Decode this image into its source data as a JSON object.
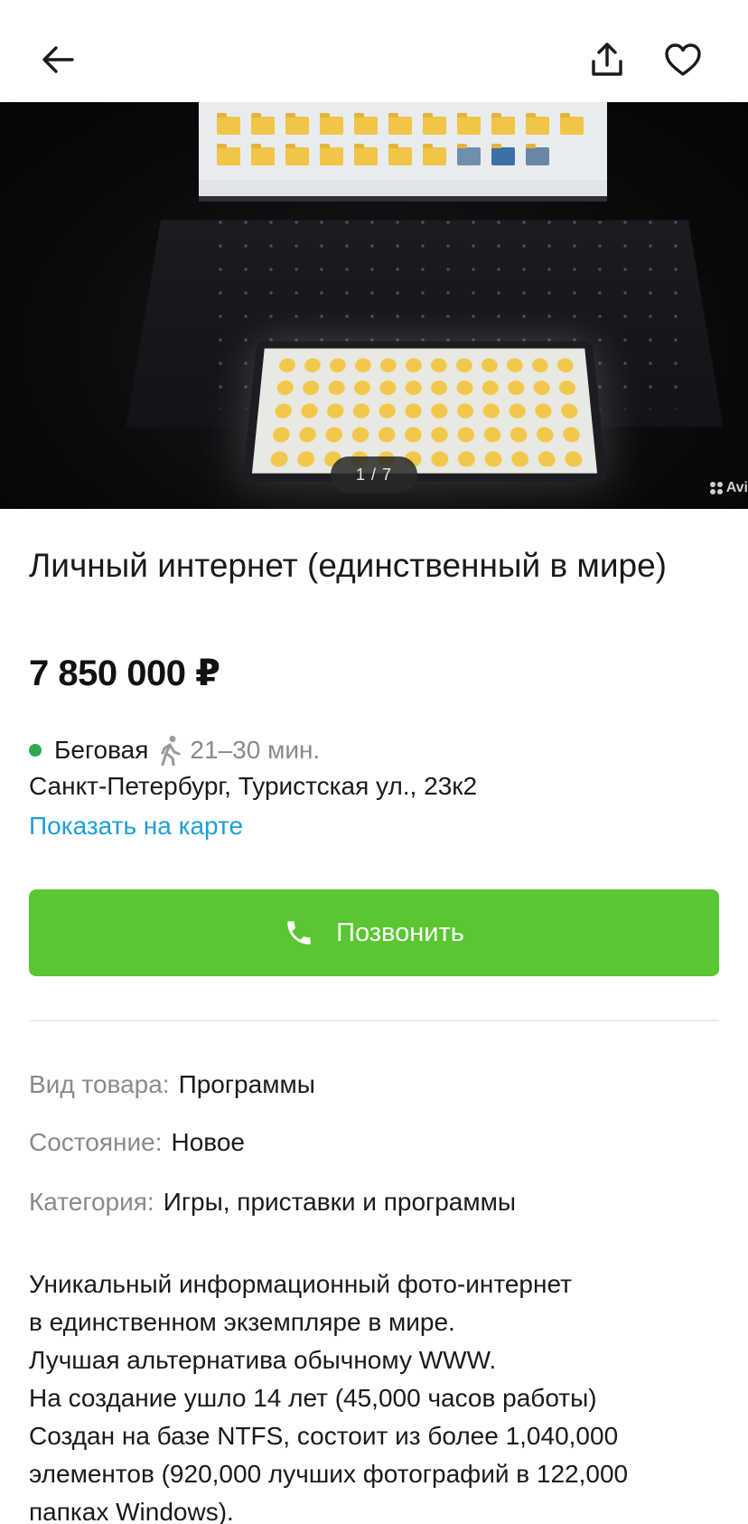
{
  "header": {
    "back_icon": "arrow-left-icon",
    "share_icon": "share-upload-icon",
    "favorite_icon": "heart-outline-icon"
  },
  "gallery": {
    "counter": "1 / 7",
    "watermark": "Avi"
  },
  "listing": {
    "title": "Личный интернет (единственный в мире)",
    "price": "7 850 000 ₽"
  },
  "location": {
    "metro_color": "#2fa84f",
    "metro_station": "Беговая",
    "walk_time": "21–30 мин.",
    "address": "Санкт-Петербург, Туристская ул., 23к2",
    "map_link": "Показать на карте"
  },
  "call_button": {
    "label": "Позвонить",
    "color": "#5ac631"
  },
  "params": [
    {
      "key": "Вид товара:",
      "value": "Программы"
    },
    {
      "key": "Состояние:",
      "value": "Новое"
    },
    {
      "key": "Категория:",
      "value": "Игры, приставки и программы"
    }
  ],
  "description": [
    "Уникальный информационный фото-интернет",
    "в единственном экземпляре в мире.",
    "Лучшая альтернатива обычному WWW.",
    "На создание ушло 14 лет (45,000 часов работы)",
    "Создан на базе NTFS, состоит из более 1,040,000",
    "элементов (920,000 лучших фотографий в 122,000",
    "папках Windows)."
  ]
}
